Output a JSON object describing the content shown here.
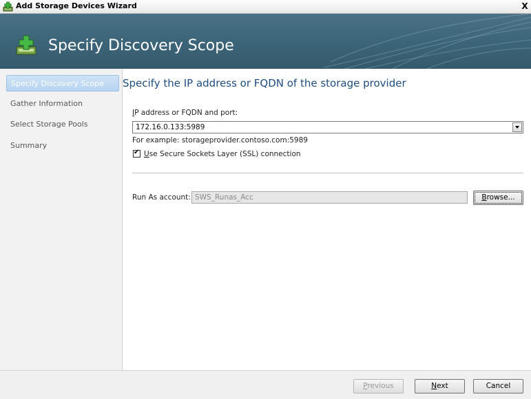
{
  "window": {
    "title": "Add Storage Devices Wizard",
    "close_glyph": "X"
  },
  "banner": {
    "heading": "Specify Discovery Scope"
  },
  "nav": {
    "items": [
      {
        "label": "Specify Discovery Scope",
        "active": true
      },
      {
        "label": "Gather Information"
      },
      {
        "label": "Select Storage Pools"
      },
      {
        "label": "Summary"
      }
    ]
  },
  "main": {
    "title": "Specify the IP address or FQDN of the storage provider",
    "address_label_mnemonic": "I",
    "address_label_rest": "P address or FQDN and port:",
    "address_value": "172.16.0.133:5989",
    "example_text": "For example: storageprovider.contoso.com:5989",
    "ssl_checked": true,
    "ssl_label_mnemonic": "U",
    "ssl_label_rest": "se Secure Sockets Layer (SSL) connection",
    "runas_label": "Run As account:",
    "runas_value": "SWS_Runas_Acc",
    "browse_mnemonic": "B",
    "browse_rest": "rowse..."
  },
  "footer": {
    "previous_mnemonic": "P",
    "previous_rest": "revious",
    "next_mnemonic": "N",
    "next_rest": "ext",
    "cancel_label": "Cancel"
  }
}
